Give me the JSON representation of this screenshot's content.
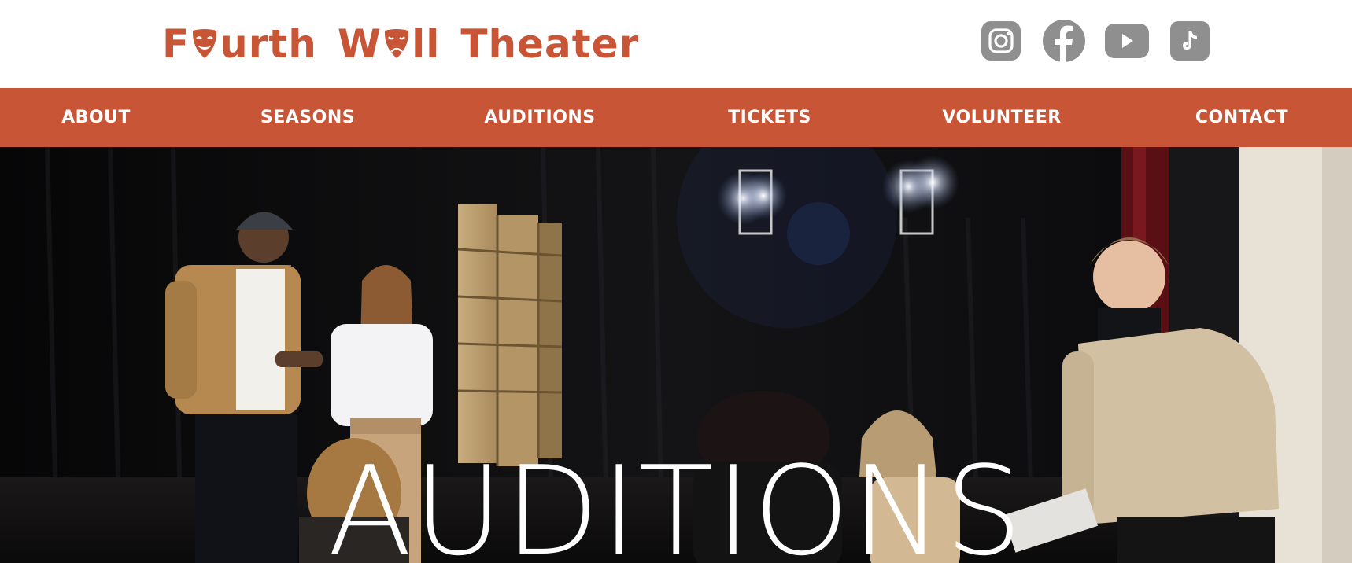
{
  "brand": {
    "name_parts": [
      "F",
      "urth",
      "W",
      "ll",
      "Theater"
    ],
    "color": "#c85535"
  },
  "socials": [
    {
      "name": "Instagram",
      "icon": "instagram-icon"
    },
    {
      "name": "Facebook",
      "icon": "facebook-icon"
    },
    {
      "name": "YouTube",
      "icon": "youtube-icon"
    },
    {
      "name": "TikTok",
      "icon": "tiktok-icon"
    }
  ],
  "social_icon_color": "#8f8f8f",
  "nav": {
    "background": "#c85535",
    "items": [
      "ABOUT",
      "SEASONS",
      "AUDITIONS",
      "TICKETS",
      "VOLUNTEER",
      "CONTACT"
    ]
  },
  "hero": {
    "title": "AUDITIONS",
    "image_description_icon": "theater-rehearsal-photo"
  }
}
